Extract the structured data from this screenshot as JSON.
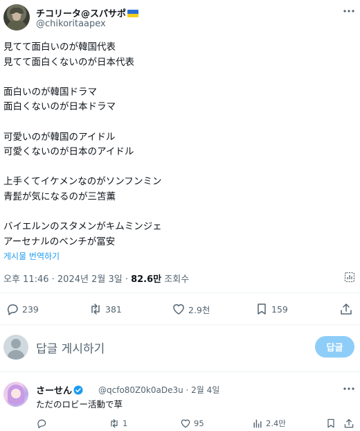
{
  "post": {
    "display_name": "チコリータ@スパサポ",
    "handle": "@chikoritaapex",
    "text_lines": [
      "見てて面白いのが韓国代表",
      "見てて面白くないのが日本代表",
      "",
      "面白いのが韓国ドラマ",
      "面白くないのが日本ドラマ",
      "",
      "可愛いのが韓国のアイドル",
      "可愛くないのが日本のアイドル",
      "",
      "上手くてイケメンなのがソンフンミン",
      "青髭が気になるのが三笘薫",
      "",
      "バイエルンのスタメンがキムミンジェ",
      "アーセナルのベンチが冨安"
    ],
    "translate_label": "게시물 번역하기",
    "time": "오후 11:46 · 2024년 2월 3일 · ",
    "views_count": "82.6만",
    "views_label": " 조회수",
    "actions": {
      "replies": "239",
      "reposts": "381",
      "likes": "2.9천",
      "bookmarks": "159"
    }
  },
  "reply_composer": {
    "placeholder": "답글 게시하기",
    "button_label": "답글"
  },
  "reply": {
    "display_name": "さーせん",
    "handle": "@qcfo80Z0k0aDe3u · 2월 4일",
    "text": "ただのロビー活動で草",
    "actions": {
      "reposts": "1",
      "likes": "95",
      "views": "2.4만"
    }
  },
  "colors": {
    "accent": "#1d9bf0",
    "muted": "#536471",
    "reply_button_disabled": "#8ecdf8"
  }
}
